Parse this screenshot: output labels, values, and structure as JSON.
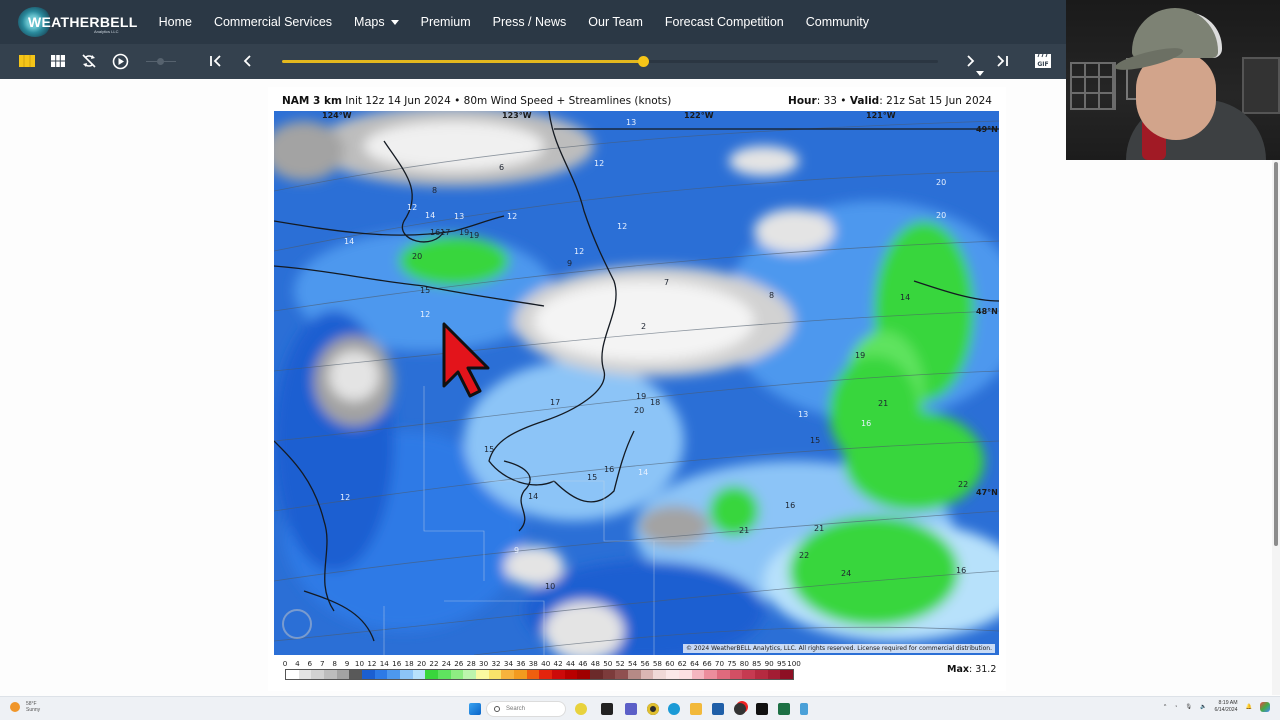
{
  "site": {
    "logo_main": "WEATHERBELL",
    "logo_sub": "Analytics LLC"
  },
  "nav": {
    "items": [
      {
        "label": "Home"
      },
      {
        "label": "Commercial Services"
      },
      {
        "label": "Maps",
        "has_dropdown": true
      },
      {
        "label": "Premium"
      },
      {
        "label": "Press / News"
      },
      {
        "label": "Our Team"
      },
      {
        "label": "Forecast Competition"
      },
      {
        "label": "Community"
      }
    ]
  },
  "toolbar": {
    "buttons": [
      {
        "name": "single-panel-view",
        "icon": "single-panel-icon",
        "active": true
      },
      {
        "name": "multi-panel-view",
        "icon": "grid-icon"
      },
      {
        "name": "sync-toggle",
        "icon": "sync-off-icon"
      },
      {
        "name": "play",
        "icon": "play-icon"
      },
      {
        "name": "first-frame",
        "icon": "skip-to-start-icon"
      },
      {
        "name": "previous-frame",
        "icon": "chevron-left-icon"
      },
      {
        "name": "next-frame",
        "icon": "chevron-right-icon"
      },
      {
        "name": "last-frame",
        "icon": "skip-to-end-icon"
      },
      {
        "name": "gif-export",
        "icon": "gif-clapper-icon",
        "label": "GIF"
      }
    ],
    "timeline_progress": 0.55,
    "accent_color": "#f5c518"
  },
  "map": {
    "header_model": "NAM 3 km",
    "header_init": "Init 12z 14 Jun 2024",
    "header_separator": "•",
    "header_product": "80m Wind Speed + Streamlines (knots)",
    "header_hour_label": "Hour",
    "header_hour_value": ": 33",
    "header_valid_label": "Valid",
    "header_valid_value": ": 21z Sat 15 Jun 2024",
    "longitude_labels": [
      "124°W",
      "123°W",
      "122°W",
      "121°W"
    ],
    "latitude_labels": [
      "49°N",
      "48°N",
      "47°N"
    ],
    "contour_labels": [
      {
        "text": "13",
        "style": "light"
      },
      {
        "text": "12",
        "style": "light"
      },
      {
        "text": "12",
        "style": "light"
      },
      {
        "text": "14",
        "style": "light"
      },
      {
        "text": "13",
        "style": "light"
      },
      {
        "text": "12",
        "style": "light"
      },
      {
        "text": "12",
        "style": "light"
      },
      {
        "text": "12",
        "style": "light"
      },
      {
        "text": "14",
        "style": "light"
      },
      {
        "text": "1617",
        "style": "dark"
      },
      {
        "text": "19",
        "style": "dark"
      },
      {
        "text": "19",
        "style": "dark"
      },
      {
        "text": "20",
        "style": "dark"
      },
      {
        "text": "15",
        "style": "dark"
      },
      {
        "text": "12",
        "style": "light"
      },
      {
        "text": "9",
        "style": "dark"
      },
      {
        "text": "7",
        "style": "dark"
      },
      {
        "text": "8",
        "style": "dark"
      },
      {
        "text": "2",
        "style": "dark"
      },
      {
        "text": "20",
        "style": "light"
      },
      {
        "text": "20",
        "style": "light"
      },
      {
        "text": "14",
        "style": "dark"
      },
      {
        "text": "19",
        "style": "dark"
      },
      {
        "text": "21",
        "style": "dark"
      },
      {
        "text": "16",
        "style": "light"
      },
      {
        "text": "13",
        "style": "light"
      },
      {
        "text": "15",
        "style": "dark"
      },
      {
        "text": "17",
        "style": "dark"
      },
      {
        "text": "19",
        "style": "dark"
      },
      {
        "text": "18",
        "style": "dark"
      },
      {
        "text": "20",
        "style": "dark"
      },
      {
        "text": "15",
        "style": "dark"
      },
      {
        "text": "16",
        "style": "dark"
      },
      {
        "text": "15",
        "style": "dark"
      },
      {
        "text": "14",
        "style": "light"
      },
      {
        "text": "14",
        "style": "dark"
      },
      {
        "text": "12",
        "style": "light"
      },
      {
        "text": "16",
        "style": "dark"
      },
      {
        "text": "21",
        "style": "dark"
      },
      {
        "text": "21",
        "style": "dark"
      },
      {
        "text": "22",
        "style": "dark"
      },
      {
        "text": "24",
        "style": "dark"
      },
      {
        "text": "16",
        "style": "dark"
      },
      {
        "text": "22",
        "style": "dark"
      },
      {
        "text": "9",
        "style": "light"
      },
      {
        "text": "10",
        "style": "dark"
      },
      {
        "text": "6",
        "style": "dark"
      },
      {
        "text": "8",
        "style": "dark"
      }
    ],
    "copyright": "© 2024 WeatherBELL Analytics, LLC. All rights reserved. License required for commercial distribution."
  },
  "colorbar": {
    "ticks": [
      "0",
      "4",
      "6",
      "7",
      "8",
      "9",
      "10",
      "12",
      "14",
      "16",
      "18",
      "20",
      "22",
      "24",
      "26",
      "28",
      "30",
      "32",
      "34",
      "36",
      "38",
      "40",
      "42",
      "44",
      "46",
      "48",
      "50",
      "52",
      "54",
      "56",
      "58",
      "60",
      "62",
      "64",
      "66",
      "70",
      "75",
      "80",
      "85",
      "90",
      "95",
      "100"
    ],
    "colors": [
      "#ffffff",
      "#e4e4e4",
      "#d2d2d2",
      "#bdbdbd",
      "#a3a3a3",
      "#595959",
      "#1b5fd1",
      "#2d7ae6",
      "#4d98ee",
      "#8cc4f7",
      "#b7e1fb",
      "#39d63c",
      "#5fe35f",
      "#8eed82",
      "#bdf5ad",
      "#fafaa0",
      "#f9e36a",
      "#f7b33c",
      "#f29b1f",
      "#ee5f0f",
      "#e3240d",
      "#cc0a0a",
      "#b80000",
      "#a00000",
      "#6b2a2a",
      "#7c3b3b",
      "#8f5050",
      "#b58a86",
      "#dab6b3",
      "#f0d9d7",
      "#fbe8e8",
      "#fde0e2",
      "#f5b6c0",
      "#ec8d9c",
      "#df6a7d",
      "#d24f64",
      "#c63a51",
      "#b52a40",
      "#a31d33",
      "#8d0f24"
    ],
    "max_label": "Max",
    "max_value": ": 31.2"
  },
  "taskbar": {
    "weather_temp": "58°F",
    "weather_desc": "Sunny",
    "search_placeholder": "Search",
    "time": "8:19 AM",
    "date": "6/14/2024"
  }
}
